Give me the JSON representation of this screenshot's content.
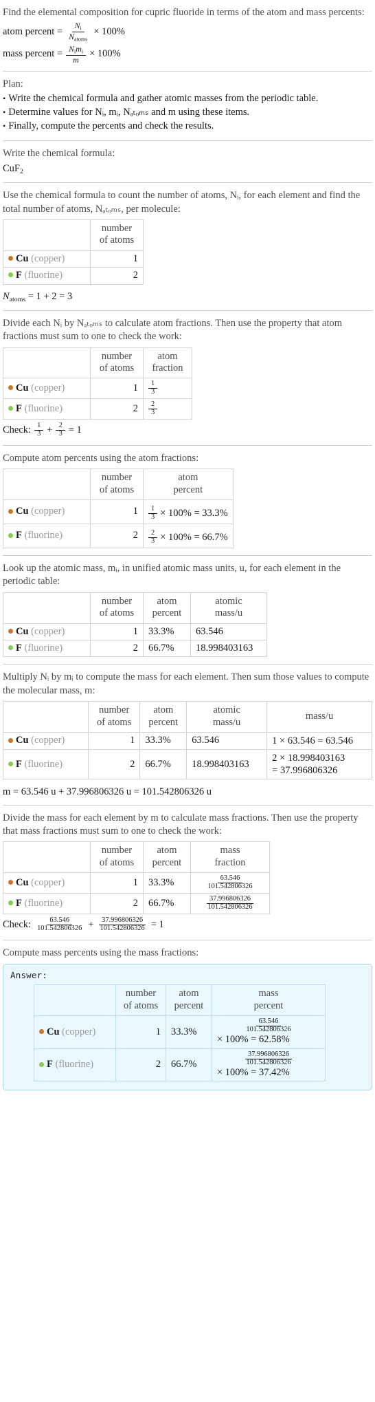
{
  "intro": {
    "prompt": "Find the elemental composition for cupric fluoride in terms of the atom and mass percents:",
    "atom_percent_label": "atom percent =",
    "atom_percent_num": "N",
    "atom_percent_num_sub": "i",
    "atom_percent_den": "N",
    "atom_percent_den_sub": "atoms",
    "times100": "× 100%",
    "mass_percent_label": "mass percent =",
    "mass_percent_num": "N",
    "mass_percent_num_sub": "i",
    "mass_percent_num2": "m",
    "mass_percent_num2_sub": "i",
    "mass_percent_den": "m"
  },
  "plan": {
    "title": "Plan:",
    "items": [
      "Write the chemical formula and gather atomic masses from the periodic table.",
      "Determine values for Nᵢ, mᵢ, Nₐₜₒₘₛ and m using these items.",
      "Finally, compute the percents and check the results."
    ]
  },
  "formula_section": {
    "lead": "Write the chemical formula:",
    "formula_main": "CuF",
    "formula_sub": "2"
  },
  "count_section": {
    "lead": "Use the chemical formula to count the number of atoms, Nᵢ, for each element and find the total number of atoms, Nₐₜₒₘₛ, per molecule:",
    "headers": [
      "",
      "number of atoms"
    ],
    "rows": [
      {
        "symbol": "Cu",
        "name": "(copper)",
        "color": "#c8762a",
        "atoms": "1"
      },
      {
        "symbol": "F",
        "name": "(fluorine)",
        "color": "#86cb4e",
        "atoms": "2"
      }
    ],
    "total_label": "N",
    "total_sub": "atoms",
    "total_expr": "= 1 + 2 = 3"
  },
  "fraction_section": {
    "lead": "Divide each Nᵢ by Nₐₜₒₘₛ to calculate atom fractions. Then use the property that atom fractions must sum to one to check the work:",
    "headers": [
      "",
      "number of atoms",
      "atom fraction"
    ],
    "rows": [
      {
        "symbol": "Cu",
        "name": "(copper)",
        "color": "#c8762a",
        "atoms": "1",
        "num": "1",
        "den": "3"
      },
      {
        "symbol": "F",
        "name": "(fluorine)",
        "color": "#86cb4e",
        "atoms": "2",
        "num": "2",
        "den": "3"
      }
    ],
    "check_label": "Check:",
    "check_f1_num": "1",
    "check_f1_den": "3",
    "check_plus": "+",
    "check_f2_num": "2",
    "check_f2_den": "3",
    "check_result": "= 1"
  },
  "atom_percent_section": {
    "lead": "Compute atom percents using the atom fractions:",
    "headers": [
      "",
      "number of atoms",
      "atom percent"
    ],
    "rows": [
      {
        "symbol": "Cu",
        "name": "(copper)",
        "color": "#c8762a",
        "atoms": "1",
        "num": "1",
        "den": "3",
        "expr": "× 100% = 33.3%"
      },
      {
        "symbol": "F",
        "name": "(fluorine)",
        "color": "#86cb4e",
        "atoms": "2",
        "num": "2",
        "den": "3",
        "expr": "× 100% = 66.7%"
      }
    ]
  },
  "atomic_mass_section": {
    "lead": "Look up the atomic mass, mᵢ, in unified atomic mass units, u, for each element in the periodic table:",
    "headers": [
      "",
      "number of atoms",
      "atom percent",
      "atomic mass/u"
    ],
    "rows": [
      {
        "symbol": "Cu",
        "name": "(copper)",
        "color": "#c8762a",
        "atoms": "1",
        "percent": "33.3%",
        "mass": "63.546"
      },
      {
        "symbol": "F",
        "name": "(fluorine)",
        "color": "#86cb4e",
        "atoms": "2",
        "percent": "66.7%",
        "mass": "18.998403163"
      }
    ]
  },
  "mass_section": {
    "lead": "Multiply Nᵢ by mᵢ to compute the mass for each element. Then sum those values to compute the molecular mass, m:",
    "headers": [
      "",
      "number of atoms",
      "atom percent",
      "atomic mass/u",
      "mass/u"
    ],
    "rows": [
      {
        "symbol": "Cu",
        "name": "(copper)",
        "color": "#c8762a",
        "atoms": "1",
        "percent": "33.3%",
        "mass": "63.546",
        "product_l1": "1 × 63.546 = 63.546",
        "product_l2": ""
      },
      {
        "symbol": "F",
        "name": "(fluorine)",
        "color": "#86cb4e",
        "atoms": "2",
        "percent": "66.7%",
        "mass": "18.998403163",
        "product_l1": "2 × 18.998403163",
        "product_l2": "= 37.996806326"
      }
    ],
    "total": "m = 63.546 u + 37.996806326 u = 101.542806326 u"
  },
  "mass_fraction_section": {
    "lead": "Divide the mass for each element by m to calculate mass fractions. Then use the property that mass fractions must sum to one to check the work:",
    "headers": [
      "",
      "number of atoms",
      "atom percent",
      "mass fraction"
    ],
    "rows": [
      {
        "symbol": "Cu",
        "name": "(copper)",
        "color": "#c8762a",
        "atoms": "1",
        "percent": "33.3%",
        "num": "63.546",
        "den": "101.542806326"
      },
      {
        "symbol": "F",
        "name": "(fluorine)",
        "color": "#86cb4e",
        "atoms": "2",
        "percent": "66.7%",
        "num": "37.996806326",
        "den": "101.542806326"
      }
    ],
    "check_label": "Check:",
    "check_f1_num": "63.546",
    "check_f1_den": "101.542806326",
    "check_plus": "+",
    "check_f2_num": "37.996806326",
    "check_f2_den": "101.542806326",
    "check_result": "= 1"
  },
  "mass_percent_section": {
    "lead": "Compute mass percents using the mass fractions:",
    "answer_label": "Answer:",
    "headers": [
      "",
      "number of atoms",
      "atom percent",
      "mass percent"
    ],
    "rows": [
      {
        "symbol": "Cu",
        "name": "(copper)",
        "color": "#c8762a",
        "atoms": "1",
        "percent": "33.3%",
        "num": "63.546",
        "den": "101.542806326",
        "expr": "× 100% = 62.58%"
      },
      {
        "symbol": "F",
        "name": "(fluorine)",
        "color": "#86cb4e",
        "atoms": "2",
        "percent": "66.7%",
        "num": "37.996806326",
        "den": "101.542806326",
        "expr": "× 100% = 37.42%"
      }
    ]
  },
  "headers_common": {
    "number_l1": "number",
    "number_l2": "of atoms",
    "atom_l1": "atom",
    "percent_l2": "percent",
    "fraction_l2": "fraction",
    "atomic_l1": "atomic",
    "massu_l2": "mass/u",
    "massu": "mass/u",
    "mass_l1": "mass"
  }
}
